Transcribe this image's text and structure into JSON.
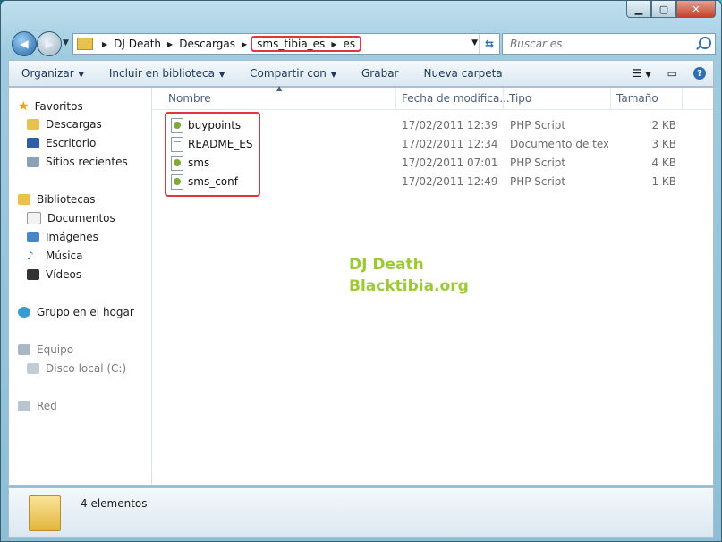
{
  "window": {
    "caption_buttons": [
      "minimize-icon",
      "maximize-icon",
      "close-icon"
    ]
  },
  "address": {
    "crumbs": [
      "DJ Death",
      "Descargas",
      "sms_tibia_es",
      "es"
    ]
  },
  "search": {
    "placeholder": "Buscar es"
  },
  "toolbar": {
    "organize": "Organizar",
    "include": "Incluir en biblioteca",
    "share": "Compartir con",
    "burn": "Grabar",
    "new_folder": "Nueva carpeta"
  },
  "nav": {
    "favorites": "Favoritos",
    "downloads": "Descargas",
    "desktop": "Escritorio",
    "recent": "Sitios recientes",
    "libraries": "Bibliotecas",
    "documents": "Documentos",
    "images": "Imágenes",
    "music": "Música",
    "videos": "Vídeos",
    "homegroup": "Grupo en el hogar",
    "computer": "Equipo",
    "local_disk": "Disco local (C:)",
    "network": "Red"
  },
  "columns": {
    "name": "Nombre",
    "date": "Fecha de modifica...",
    "type": "Tipo",
    "size": "Tamaño"
  },
  "files": [
    {
      "name": "buypoints",
      "date": "17/02/2011 12:39 a...",
      "type": "PHP Script",
      "size": "2 KB",
      "icon": "php-file-icon"
    },
    {
      "name": "README_ES",
      "date": "17/02/2011 12:34 a...",
      "type": "Documento de tex...",
      "size": "3 KB",
      "icon": "text-file-icon"
    },
    {
      "name": "sms",
      "date": "17/02/2011 07:01 ...",
      "type": "PHP Script",
      "size": "4 KB",
      "icon": "php-file-icon"
    },
    {
      "name": "sms_conf",
      "date": "17/02/2011 12:49 a...",
      "type": "PHP Script",
      "size": "1 KB",
      "icon": "php-file-icon"
    }
  ],
  "watermark": {
    "line1": "DJ Death",
    "line2": "Blacktibia.org"
  },
  "status": {
    "count": "4 elementos"
  },
  "colors": {
    "annotation_red": "#e0363f",
    "watermark_green": "#9dc935"
  }
}
